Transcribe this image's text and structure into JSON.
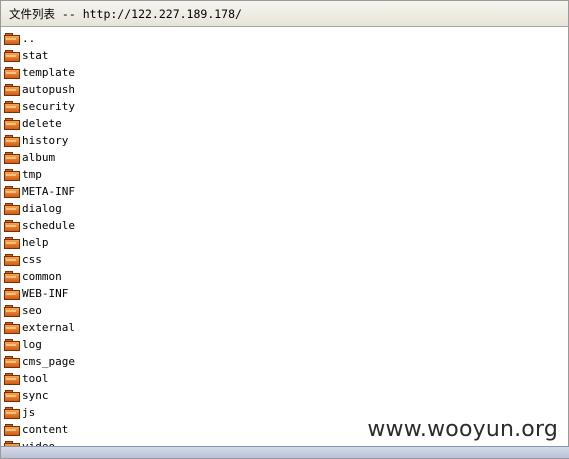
{
  "window": {
    "title": "文件列表 -- http://122.227.189.178/"
  },
  "folders": [
    {
      "label": ".."
    },
    {
      "label": "stat"
    },
    {
      "label": "template"
    },
    {
      "label": "autopush"
    },
    {
      "label": "security"
    },
    {
      "label": "delete"
    },
    {
      "label": "history"
    },
    {
      "label": "album"
    },
    {
      "label": "tmp"
    },
    {
      "label": "META-INF"
    },
    {
      "label": "dialog"
    },
    {
      "label": "schedule"
    },
    {
      "label": "help"
    },
    {
      "label": "css"
    },
    {
      "label": "common"
    },
    {
      "label": "WEB-INF"
    },
    {
      "label": "seo"
    },
    {
      "label": "external"
    },
    {
      "label": "log"
    },
    {
      "label": "cms_page"
    },
    {
      "label": "tool"
    },
    {
      "label": "sync"
    },
    {
      "label": "js"
    },
    {
      "label": "content"
    },
    {
      "label": "video"
    }
  ],
  "icons": {
    "folder": "folder-icon"
  },
  "watermark": {
    "text": "www.wooyun.org"
  },
  "colors": {
    "folder": "#d35b14",
    "title_bar": "#ecebe0"
  }
}
